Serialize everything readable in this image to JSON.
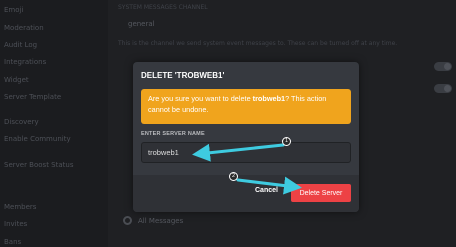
{
  "sidebar": {
    "items": [
      "Emoji",
      "Moderation",
      "Audit Log",
      "Integrations",
      "Widget",
      "Server Template",
      "Discovery",
      "Enable Community",
      "Server Boost Status",
      "Members",
      "Invites",
      "Bans"
    ]
  },
  "main": {
    "section_label": "SYSTEM MESSAGES CHANNEL",
    "channel_value": "general",
    "description": "This is the channel we send system event messages to. These can be turned off at any time.",
    "radio_label": "All Messages"
  },
  "modal": {
    "title": "DELETE 'TROBWEB1'",
    "warning_prefix": "Are you sure you want to delete ",
    "server_name": "trobweb1",
    "warning_suffix": "? This action cannot be undone.",
    "field_label": "ENTER SERVER NAME",
    "input_value": "trobweb1",
    "cancel_label": "Cancel",
    "delete_label": "Delete Server"
  },
  "annotations": {
    "step1": "1",
    "step2": "2",
    "arrow_color": "#3ecbe0"
  },
  "colors": {
    "warning": "#f0a41d",
    "danger": "#ed4245",
    "modal_bg": "#36393f"
  }
}
